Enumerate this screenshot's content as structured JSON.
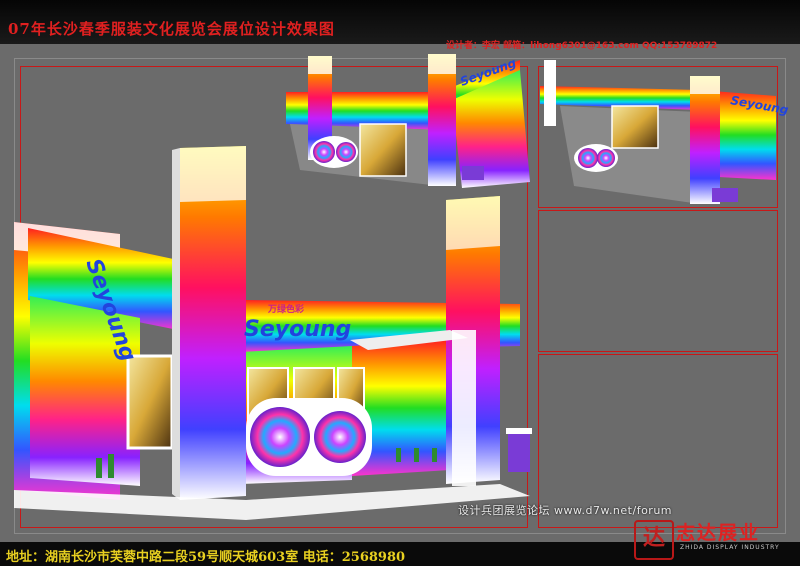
{
  "header": {
    "title": "07年长沙春季服装文化展览会展位设计效果图",
    "designer_line": "设计者：李宏   邮箱：lihong6301@163.com   QQ:153789872"
  },
  "booth_signage": {
    "brand_name": "Seyoung",
    "brand_cn": "万绿色彩"
  },
  "footer": {
    "address": "地址：湖南长沙市芙蓉中路二段59号顺天城603室 电话：2568980",
    "forum_watermark": "设计兵团展览论坛 www.d7w.net/forum",
    "logo_text": "志达展业",
    "logo_subtext": "ZHIDA DISPLAY INDUSTRY",
    "logo_mark": "达"
  },
  "colors": {
    "frame_red": "#c81818",
    "title_red": "#e02020",
    "address_yellow": "#e8d020",
    "background_gray": "#6b6b6b"
  }
}
